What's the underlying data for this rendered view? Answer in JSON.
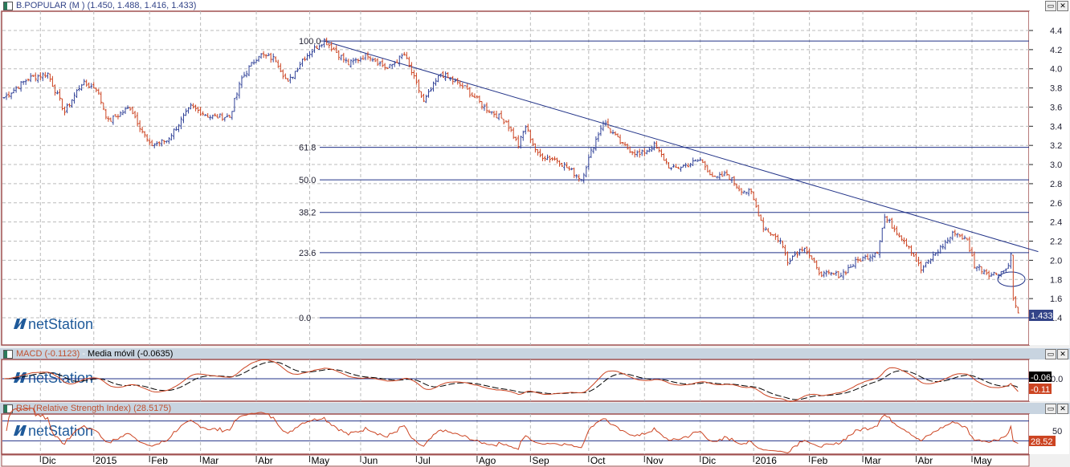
{
  "main": {
    "title": "B.POPULAR (M ) (1.450, 1.488, 1.416, 1.433)",
    "last_price": "1.433"
  },
  "macd": {
    "title_a": "MACD (-0.1123)",
    "title_sep": " - ",
    "title_b": "Media móvil (-0.0635)",
    "macd_label": "-0.11",
    "signal_label": "-0.06",
    "axis_label": "0.0"
  },
  "rsi": {
    "title": "RSI (Relative Strength Index) (28.5175)",
    "value_label": "28.52",
    "axis_label": "50"
  },
  "watermark": "netStation",
  "colors": {
    "up": "#334499",
    "down": "#cc4422",
    "line": "#223388",
    "frame": "#a05050"
  },
  "chart_data": {
    "type": "ohlc",
    "title": "B.POPULAR (M )",
    "ylim": [
      1.3,
      4.5
    ],
    "yticks": [
      "4.4",
      "4.2",
      "4.0",
      "3.8",
      "3.6",
      "3.4",
      "3.2",
      "3.0",
      "2.8",
      "2.6",
      "2.4",
      "2.2",
      "2.0",
      "1.8",
      "1.6",
      "1.4"
    ],
    "xticks": [
      "Dic",
      "2015",
      "Feb",
      "Mar",
      "Abr",
      "May",
      "Jun",
      "Jul",
      "Ago",
      "Sep",
      "Oct",
      "Nov",
      "Dic",
      "2016",
      "Feb",
      "Mar",
      "Abr",
      "May"
    ],
    "xtick_days": [
      15,
      37,
      60,
      81,
      104,
      126,
      147,
      170,
      195,
      217,
      241,
      264,
      287,
      309,
      332,
      354,
      376,
      399
    ],
    "fib_levels": [
      {
        "label": "100.0",
        "price": 4.29
      },
      {
        "label": "61.8",
        "price": 3.18
      },
      {
        "label": "50.0",
        "price": 2.84
      },
      {
        "label": "38.2",
        "price": 2.5
      },
      {
        "label": "23.6",
        "price": 2.08
      },
      {
        "label": "0.0",
        "price": 1.4
      }
    ],
    "trendline": [
      [
        132,
        4.29
      ],
      [
        423,
        2.09
      ]
    ],
    "price_anchors": [
      [
        0,
        3.7
      ],
      [
        10,
        3.9
      ],
      [
        18,
        3.95
      ],
      [
        25,
        3.55
      ],
      [
        32,
        3.85
      ],
      [
        38,
        3.8
      ],
      [
        43,
        3.45
      ],
      [
        52,
        3.6
      ],
      [
        60,
        3.2
      ],
      [
        67,
        3.25
      ],
      [
        77,
        3.6
      ],
      [
        85,
        3.5
      ],
      [
        93,
        3.5
      ],
      [
        98,
        3.9
      ],
      [
        105,
        4.15
      ],
      [
        112,
        4.1
      ],
      [
        117,
        3.85
      ],
      [
        123,
        4.1
      ],
      [
        132,
        4.3
      ],
      [
        142,
        4.05
      ],
      [
        150,
        4.15
      ],
      [
        158,
        4.0
      ],
      [
        165,
        4.15
      ],
      [
        173,
        3.65
      ],
      [
        180,
        3.95
      ],
      [
        190,
        3.8
      ],
      [
        198,
        3.6
      ],
      [
        207,
        3.45
      ],
      [
        212,
        3.2
      ],
      [
        215,
        3.4
      ],
      [
        220,
        3.1
      ],
      [
        228,
        3.05
      ],
      [
        238,
        2.85
      ],
      [
        243,
        3.2
      ],
      [
        247,
        3.45
      ],
      [
        255,
        3.2
      ],
      [
        262,
        3.1
      ],
      [
        268,
        3.2
      ],
      [
        275,
        2.95
      ],
      [
        282,
        3.0
      ],
      [
        287,
        3.05
      ],
      [
        293,
        2.85
      ],
      [
        298,
        2.9
      ],
      [
        303,
        2.75
      ],
      [
        308,
        2.7
      ],
      [
        313,
        2.35
      ],
      [
        320,
        2.2
      ],
      [
        323,
        2.0
      ],
      [
        330,
        2.15
      ],
      [
        335,
        1.9
      ],
      [
        338,
        1.85
      ],
      [
        345,
        1.85
      ],
      [
        352,
        2.0
      ],
      [
        357,
        2.05
      ],
      [
        360,
        2.1
      ],
      [
        363,
        2.45
      ],
      [
        368,
        2.3
      ],
      [
        373,
        2.15
      ],
      [
        378,
        1.9
      ],
      [
        385,
        2.1
      ],
      [
        392,
        2.3
      ],
      [
        397,
        2.2
      ],
      [
        400,
        1.95
      ],
      [
        407,
        1.85
      ],
      [
        413,
        1.9
      ],
      [
        415,
        2.05
      ],
      [
        416,
        1.6
      ],
      [
        418,
        1.45
      ]
    ],
    "macd_params": [
      12,
      26,
      9
    ],
    "rsi_period": 14,
    "rsi_levels": [
      70,
      30
    ]
  }
}
